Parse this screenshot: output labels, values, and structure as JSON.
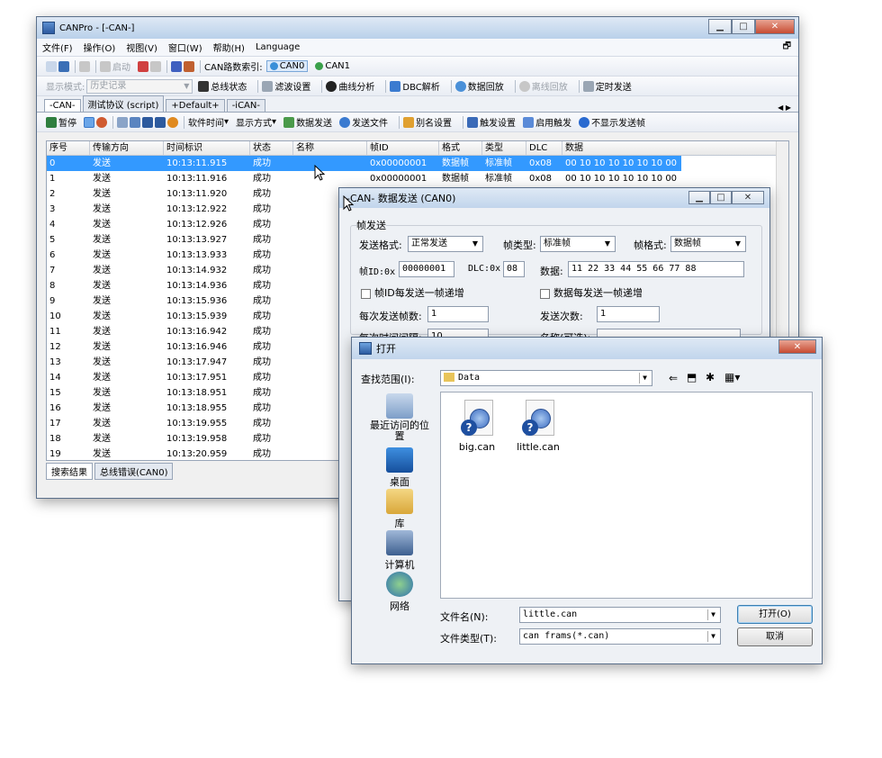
{
  "main_window": {
    "title": "CANPro - [-CAN-]",
    "menu": [
      "文件(F)",
      "操作(O)",
      "视图(V)",
      "窗口(W)",
      "帮助(H)",
      "Language"
    ],
    "toolbar1": {
      "start_label": "启动",
      "route_label": "CAN路数索引:",
      "can0": "CAN0",
      "can1": "CAN1"
    },
    "toolbar2": {
      "mode_label": "显示模式:",
      "mode_value": "历史记录",
      "bus_status": "总线状态",
      "filter_settings": "滤波设置",
      "curve_analysis": "曲线分析",
      "dbc_parse": "DBC解析",
      "data_playback": "数据回放",
      "offline_playback": "离线回放",
      "timed_send": "定时发送"
    },
    "tabs": [
      "-CAN-",
      "测试协议 (script)",
      "+Default+",
      "-iCAN-"
    ],
    "toolbar3": {
      "pause": "暂停",
      "software_time": "软件时间",
      "display_mode": "显示方式",
      "data_send": "数据发送",
      "send_file": "发送文件",
      "alias_settings": "别名设置",
      "trigger_settings": "触发设置",
      "enable_trigger": "启用触发",
      "hide_sent": "不显示发送帧"
    },
    "columns": [
      "序号",
      "传输方向",
      "时间标识",
      "状态",
      "名称",
      "帧ID",
      "格式",
      "类型",
      "DLC",
      "数据"
    ],
    "rows": [
      [
        "0",
        "发送",
        "10:13:11.915",
        "成功",
        "",
        "0x00000001",
        "数据帧",
        "标准帧",
        "0x08",
        "00 10 10 10 10 10 10 00"
      ],
      [
        "1",
        "发送",
        "10:13:11.916",
        "成功",
        "",
        "0x00000001",
        "数据帧",
        "标准帧",
        "0x08",
        "00 10 10 10 10 10 10 00"
      ],
      [
        "2",
        "发送",
        "10:13:11.920",
        "成功",
        "",
        "",
        "",
        "",
        "",
        ""
      ],
      [
        "3",
        "发送",
        "10:13:12.922",
        "成功",
        "",
        "",
        "",
        "",
        "",
        ""
      ],
      [
        "4",
        "发送",
        "10:13:12.926",
        "成功",
        "",
        "",
        "",
        "",
        "",
        ""
      ],
      [
        "5",
        "发送",
        "10:13:13.927",
        "成功",
        "",
        "",
        "",
        "",
        "",
        ""
      ],
      [
        "6",
        "发送",
        "10:13:13.933",
        "成功",
        "",
        "",
        "",
        "",
        "",
        ""
      ],
      [
        "7",
        "发送",
        "10:13:14.932",
        "成功",
        "",
        "",
        "",
        "",
        "",
        ""
      ],
      [
        "8",
        "发送",
        "10:13:14.936",
        "成功",
        "",
        "",
        "",
        "",
        "",
        ""
      ],
      [
        "9",
        "发送",
        "10:13:15.936",
        "成功",
        "",
        "",
        "",
        "",
        "",
        ""
      ],
      [
        "10",
        "发送",
        "10:13:15.939",
        "成功",
        "",
        "",
        "",
        "",
        "",
        ""
      ],
      [
        "11",
        "发送",
        "10:13:16.942",
        "成功",
        "",
        "",
        "",
        "",
        "",
        ""
      ],
      [
        "12",
        "发送",
        "10:13:16.946",
        "成功",
        "",
        "",
        "",
        "",
        "",
        ""
      ],
      [
        "13",
        "发送",
        "10:13:17.947",
        "成功",
        "",
        "",
        "",
        "",
        "",
        ""
      ],
      [
        "14",
        "发送",
        "10:13:17.951",
        "成功",
        "",
        "",
        "",
        "",
        "",
        ""
      ],
      [
        "15",
        "发送",
        "10:13:18.951",
        "成功",
        "",
        "",
        "",
        "",
        "",
        ""
      ],
      [
        "16",
        "发送",
        "10:13:18.955",
        "成功",
        "",
        "",
        "",
        "",
        "",
        ""
      ],
      [
        "17",
        "发送",
        "10:13:19.955",
        "成功",
        "",
        "",
        "",
        "",
        "",
        ""
      ],
      [
        "18",
        "发送",
        "10:13:19.958",
        "成功",
        "",
        "",
        "",
        "",
        "",
        ""
      ],
      [
        "19",
        "发送",
        "10:13:20.959",
        "成功",
        "",
        "",
        "",
        "",
        "",
        ""
      ]
    ],
    "bottom_tabs": [
      "搜索结果",
      "总线错误(CAN0)"
    ]
  },
  "send_dialog": {
    "title": "-CAN- 数据发送 (CAN0)",
    "group": "帧发送",
    "send_format_label": "发送格式:",
    "send_format_value": "正常发送",
    "frame_type_label": "帧类型:",
    "frame_type_value": "标准帧",
    "frame_format_label": "帧格式:",
    "frame_format_value": "数据帧",
    "frame_id_label": "帧ID:0x",
    "frame_id_value": "00000001",
    "dlc_label": "DLC:0x",
    "dlc_value": "08",
    "data_label": "数据:",
    "data_value": "11 22 33 44 55 66 77 88",
    "id_increment": "帧ID每发送一帧递增",
    "data_increment": "数据每发送一帧递增",
    "frames_per_send_label": "每次发送帧数:",
    "frames_per_send_value": "1",
    "send_count_label": "发送次数:",
    "send_count_value": "1",
    "interval_label": "每次时间间隔:",
    "interval_value": "10",
    "name_label": "名称(可选):"
  },
  "open_dialog": {
    "title": "打开",
    "look_in_label": "查找范围(I):",
    "look_in_value": "Data",
    "places": [
      "最近访问的位置",
      "桌面",
      "库",
      "计算机",
      "网络"
    ],
    "files": [
      "big.can",
      "little.can"
    ],
    "filename_label": "文件名(N):",
    "filename_value": "little.can",
    "filetype_label": "文件类型(T):",
    "filetype_value": "can frams(*.can)",
    "open_button": "打开(O)",
    "cancel_button": "取消"
  }
}
